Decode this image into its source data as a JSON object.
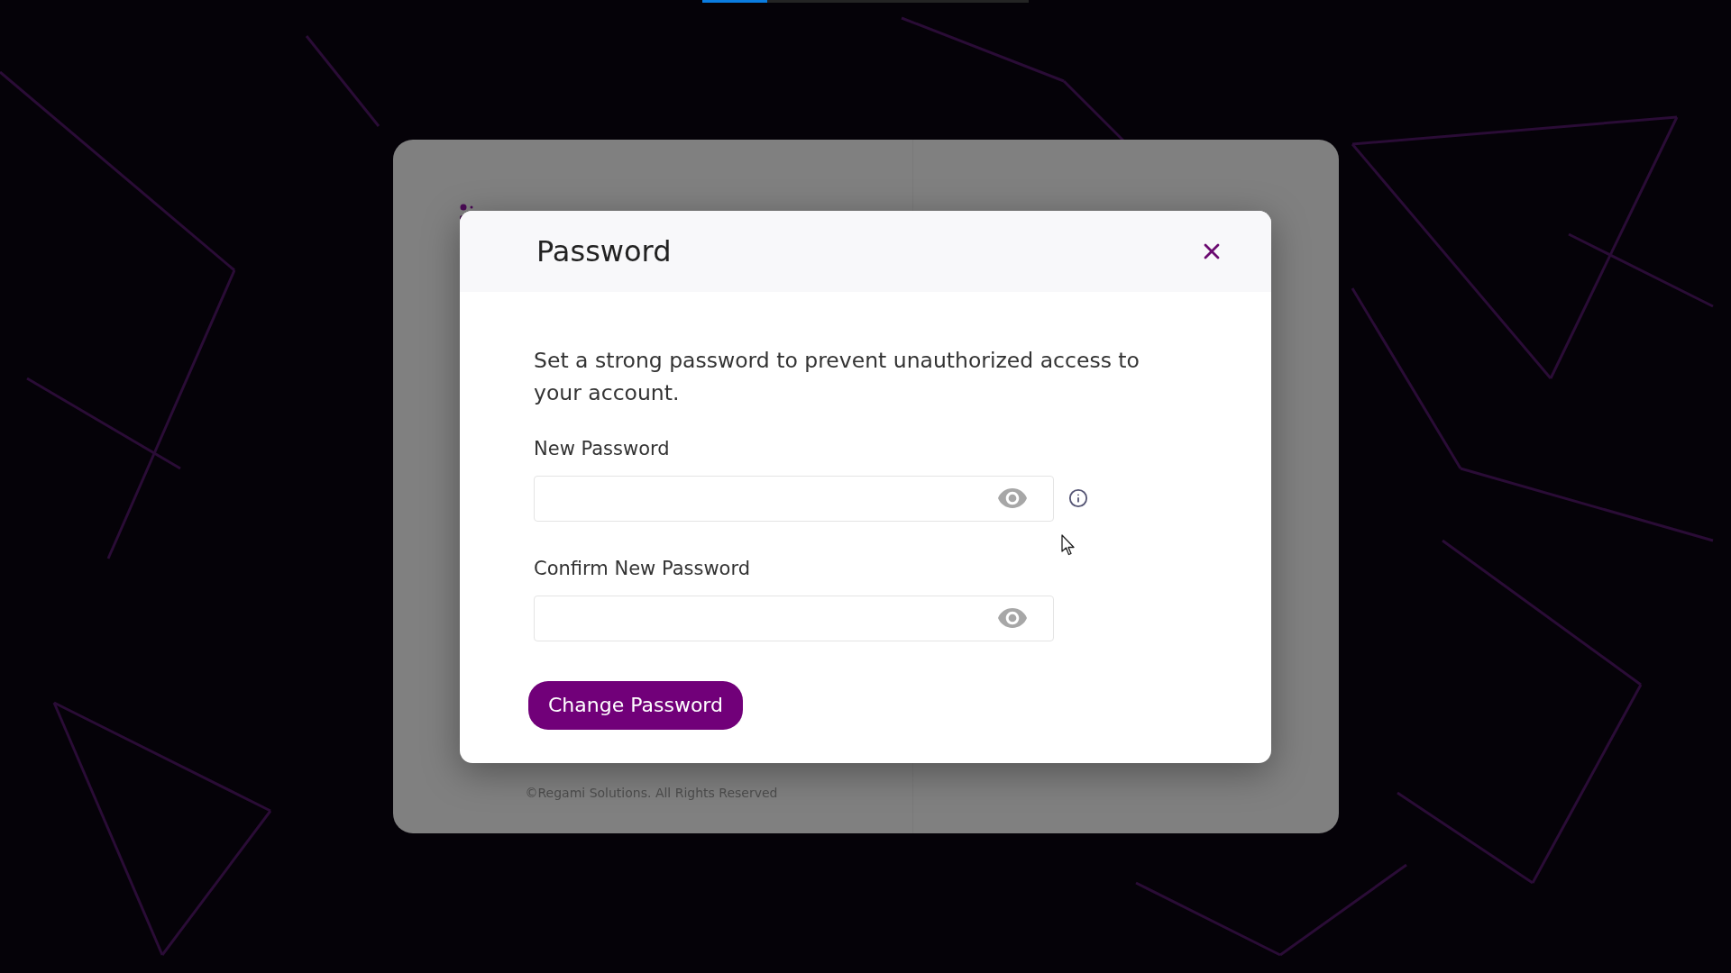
{
  "loading_bar": {
    "level": 0.2
  },
  "login_card": {
    "footer": "©Regami Solutions. All Rights Reserved"
  },
  "dialog": {
    "title": "Password",
    "description": "Set a strong password to prevent unauthorized access to your account.",
    "fields": [
      {
        "label": "New Password",
        "info": true
      },
      {
        "label": "Confirm New Password",
        "info": false
      }
    ],
    "submit": "Change Password"
  }
}
